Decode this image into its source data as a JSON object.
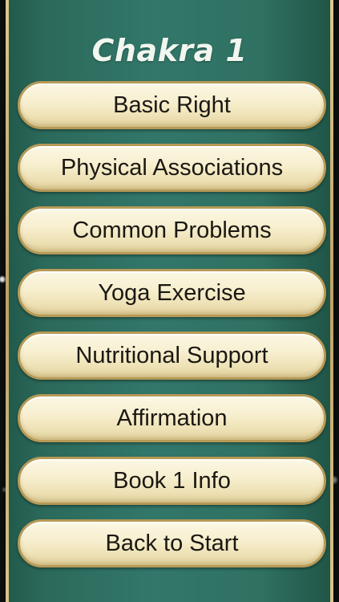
{
  "header": {
    "title": "Chakra 1"
  },
  "menu": {
    "items": [
      {
        "label": "Basic Right"
      },
      {
        "label": "Physical Associations"
      },
      {
        "label": "Common Problems"
      },
      {
        "label": "Yoga Exercise"
      },
      {
        "label": "Nutritional Support"
      },
      {
        "label": "Affirmation"
      },
      {
        "label": "Book 1 Info"
      },
      {
        "label": "Back to Start"
      }
    ]
  },
  "colors": {
    "panel": "#2f7162",
    "button_fill": "#f7efcf",
    "button_border": "#b79a56",
    "title_text": "#f1f6ef",
    "button_text": "#1a1812"
  }
}
